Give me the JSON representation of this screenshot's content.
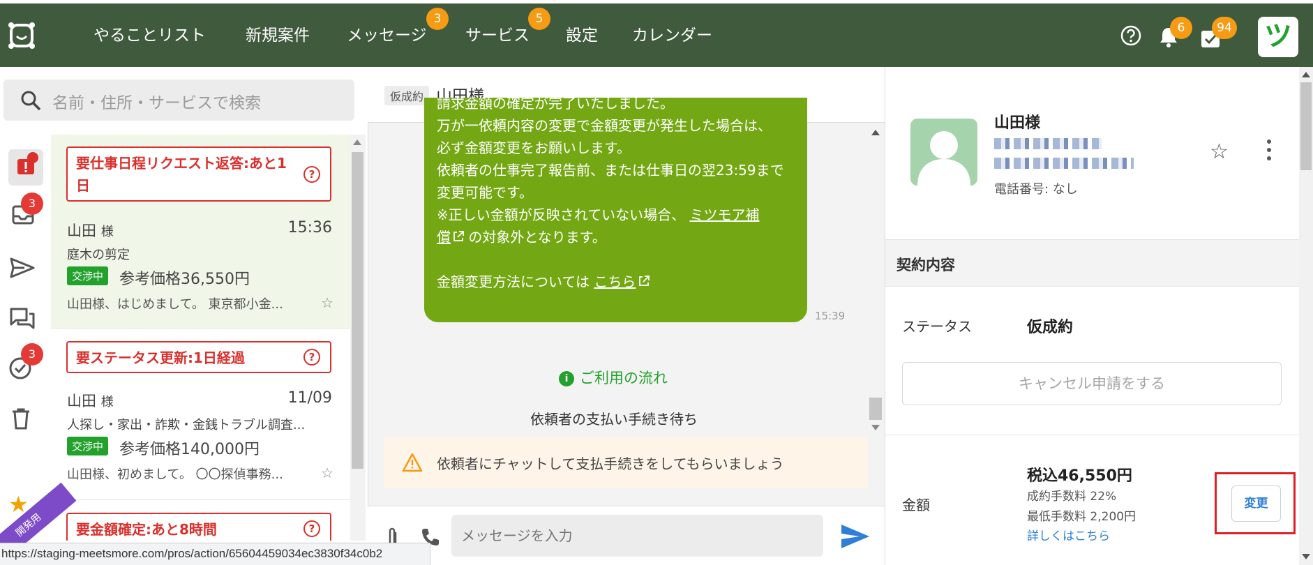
{
  "header": {
    "nav": [
      {
        "label": "やることリスト"
      },
      {
        "label": "新規案件"
      },
      {
        "label": "メッセージ",
        "badge": "3"
      },
      {
        "label": "サービス",
        "badge": "5"
      },
      {
        "label": "設定"
      },
      {
        "label": "カレンダー"
      }
    ],
    "notifications_badge": "6",
    "tasks_badge": "94",
    "avatar_letter": "ツ",
    "colors": {
      "bar": "#405a3e",
      "badge": "#f59b14"
    }
  },
  "rail": {
    "inbox_badge": "3",
    "done_badge": "3"
  },
  "search": {
    "placeholder": "名前・住所・サービスで検索"
  },
  "requests": [
    {
      "alert": "要仕事日程リクエスト返答:あと1日",
      "name": "山田",
      "honorific": "様",
      "time": "15:36",
      "service": "庭木の剪定",
      "tag": "交渉中",
      "price": "参考価格36,550円",
      "preview": "山田様、はじめまして。 東京都小金..."
    },
    {
      "alert": "要ステータス更新:1日経過",
      "name": "山田",
      "honorific": "様",
      "time": "11/09",
      "service": "人探し・家出・詐欺・金銭トラブル調査...",
      "tag": "交渉中",
      "price": "参考価格140,000円",
      "preview": "山田様、初めまして。 〇〇探偵事務..."
    },
    {
      "alert": "要金額確定:あと8時間"
    }
  ],
  "ribbon_text": "開発用",
  "chat": {
    "status_tag": "仮成約",
    "customer_name": "山田様",
    "message_lines": [
      "請求金額の確定が完了いたしました。",
      "万が一依頼内容の変更で金額変更が発生した場合は、",
      "必ず金額変更をお願いします。",
      "依頼者の仕事完了報告前、または仕事日の翌23:59まで",
      "変更可能です。",
      "※正しい金額が反映されていない場合、"
    ],
    "link_mitsumore_1": "ミツモア補",
    "link_mitsumore_2": "償",
    "after_link": " の対象外となります。",
    "change_method_prefix": "金額変更方法については ",
    "change_method_link": "こちら",
    "message_time": "15:39",
    "flow_link": "ご利用の流れ",
    "waiting_text": "依頼者の支払い手続き待ち",
    "warning_text": "依頼者にチャットして支払手続きをしてもらいましょう",
    "input_placeholder": "メッセージを入力"
  },
  "customer": {
    "name": "山田様",
    "phone": "電話番号: なし"
  },
  "contract": {
    "section_title": "契約内容",
    "status_label": "ステータス",
    "status_value": "仮成約",
    "cancel_button": "キャンセル申請をする",
    "amount_label": "金額",
    "amount_value": "税込46,550円",
    "fee_rate": "成約手数料 22%",
    "fee_min": "最低手数料 2,200円",
    "detail_link": "詳しくはこちら",
    "change_button": "変更"
  },
  "status_url": "https://staging-meetsmore.com/pros/action/65604459034ec3830f34c0b2"
}
